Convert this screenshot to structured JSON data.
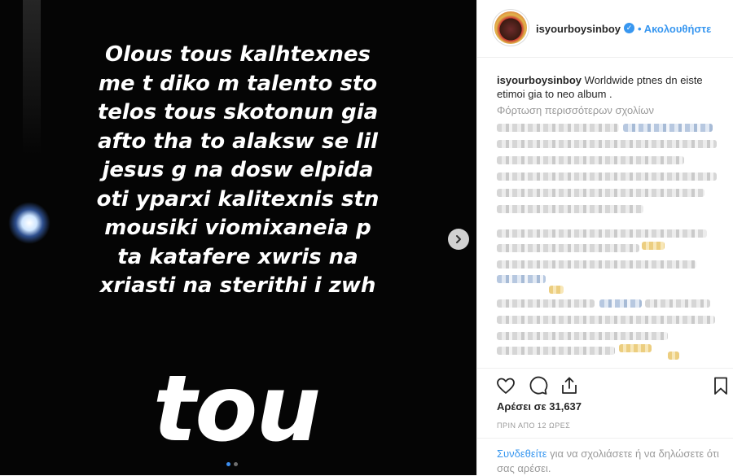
{
  "story": {
    "lines": [
      "Olous tous kalhtexnes",
      "me t diko m talento sto",
      "telos tous skotonun gia",
      "afto tha to alaksw se lil",
      "jesus g na dosw elpida",
      "oti yparxi kalitexnis stn",
      "mousiki viomixaneia p",
      "ta katafere xwris na",
      "xriasti na sterithi i zwh"
    ],
    "big_text": "tou"
  },
  "post": {
    "username": "isyourboysinboy",
    "verified_mark": "✓",
    "separator": "•",
    "follow_label": "Ακολουθήστε",
    "caption_user": "isyourboysinboy",
    "caption_text": "Worldwide ptnes dn eiste etimoi gia to neo album .",
    "load_more_label": "Φόρτωση περισσότερων σχολίων",
    "likes_text": "Αρέσει σε 31,637",
    "time_text": "ΠΡΙΝ ΑΠΟ 12 ΩΡΕΣ",
    "login_link": "Συνδεθείτε",
    "login_rest": " για να σχολιάσετε ή να δηλώσετε ότι σας αρέσει."
  },
  "icons": {
    "like": "heart-icon",
    "comment": "comment-icon",
    "share": "share-icon",
    "save": "bookmark-icon",
    "next": "chevron-right-icon"
  },
  "colors": {
    "accent": "#3897f0",
    "text": "#262626",
    "muted": "#999999",
    "media_bg": "#050505"
  }
}
